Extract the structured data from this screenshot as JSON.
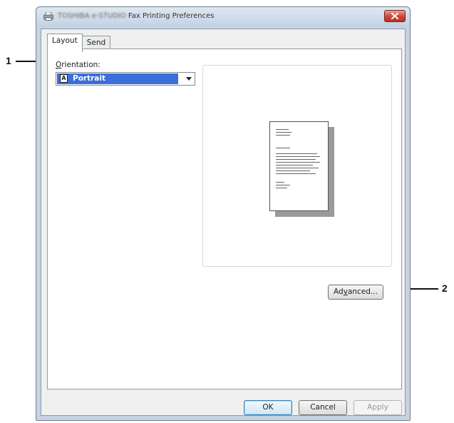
{
  "window": {
    "title_obscured": "TOSHIBA e-STUDIO",
    "title": "Fax Printing Preferences",
    "close_icon": "close-x-icon"
  },
  "tabs": [
    {
      "label": "Layout",
      "active": true
    },
    {
      "label": "Send",
      "active": false
    }
  ],
  "layout": {
    "orientation_label_accel": "O",
    "orientation_label_rest": "rientation:",
    "orientation_value": "Portrait",
    "advanced_label_pre": "Ad",
    "advanced_label_accel": "v",
    "advanced_label_post": "anced..."
  },
  "footer": {
    "ok_label": "OK",
    "cancel_label": "Cancel",
    "apply_label": "Apply",
    "apply_enabled": false
  },
  "callouts": {
    "c1": "1",
    "c2": "2"
  },
  "colors": {
    "selection": "#3a6ed8",
    "close_button": "#c8473a"
  }
}
